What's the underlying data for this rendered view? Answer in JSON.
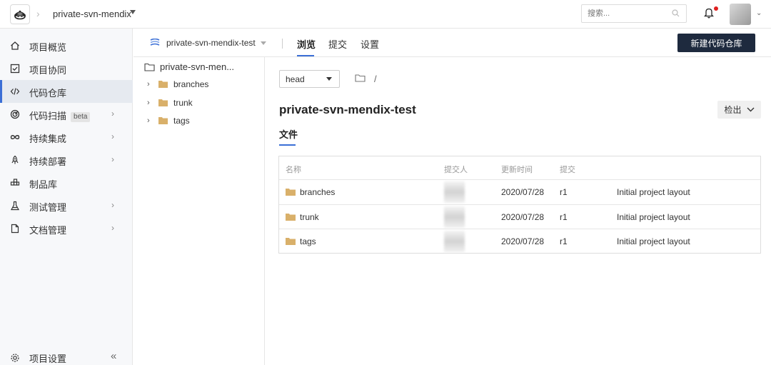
{
  "header": {
    "project_name": "private-svn-mendix",
    "search_placeholder": "搜索..."
  },
  "sidebar": {
    "items": [
      {
        "label": "项目概览",
        "icon": "home-icon",
        "has_chevron": false
      },
      {
        "label": "项目协同",
        "icon": "checkbox-icon",
        "has_chevron": false
      },
      {
        "label": "代码仓库",
        "icon": "code-icon",
        "has_chevron": false,
        "active": true
      },
      {
        "label": "代码扫描",
        "icon": "scan-icon",
        "has_chevron": true,
        "badge": "beta"
      },
      {
        "label": "持续集成",
        "icon": "infinity-icon",
        "has_chevron": true
      },
      {
        "label": "持续部署",
        "icon": "rocket-icon",
        "has_chevron": true
      },
      {
        "label": "制品库",
        "icon": "package-icon",
        "has_chevron": false
      },
      {
        "label": "测试管理",
        "icon": "flask-icon",
        "has_chevron": true
      },
      {
        "label": "文档管理",
        "icon": "document-icon",
        "has_chevron": true
      }
    ],
    "settings_label": "项目设置",
    "collapse_glyph": "«"
  },
  "subbar": {
    "repo_name": "private-svn-mendix-test",
    "tabs": [
      {
        "label": "浏览",
        "active": true
      },
      {
        "label": "提交",
        "active": false
      },
      {
        "label": "设置",
        "active": false
      }
    ],
    "new_repo_button": "新建代码仓库"
  },
  "tree": {
    "root": "private-svn-men...",
    "items": [
      "branches",
      "trunk",
      "tags"
    ]
  },
  "content": {
    "branch": "head",
    "path_slash": "/",
    "repo_title": "private-svn-mendix-test",
    "checkout_button": "检出",
    "files_tab": "文件",
    "table": {
      "headers": [
        "名称",
        "提交人",
        "更新时间",
        "提交"
      ],
      "rows": [
        {
          "name": "branches",
          "date": "2020/07/28",
          "rev": "r1",
          "message": "Initial project layout"
        },
        {
          "name": "trunk",
          "date": "2020/07/28",
          "rev": "r1",
          "message": "Initial project layout"
        },
        {
          "name": "tags",
          "date": "2020/07/28",
          "rev": "r1",
          "message": "Initial project layout"
        }
      ]
    }
  },
  "colors": {
    "accent": "#3b6fd6",
    "primary_button": "#1e2a3e",
    "folder": "#d9b06a",
    "notification_dot": "#e02020"
  }
}
